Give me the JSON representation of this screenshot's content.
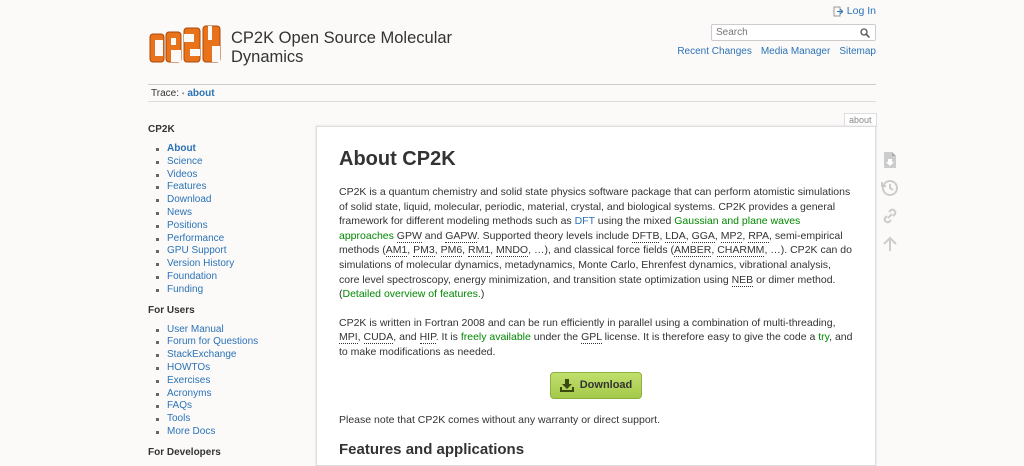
{
  "site": {
    "title": "CP2K Open Source Molecular Dynamics",
    "logo_text": "CP2K"
  },
  "usertools": {
    "login": "Log In"
  },
  "search": {
    "placeholder": "Search"
  },
  "toolnav": [
    "Recent Changes",
    "Media Manager",
    "Sitemap"
  ],
  "breadcrumb": {
    "label": "Trace:",
    "sep": "•",
    "current": "about"
  },
  "sidebar": {
    "sections": [
      {
        "title": "CP2K",
        "items": [
          "About",
          "Science",
          "Videos",
          "Features",
          "Download",
          "News",
          "Positions",
          "Performance",
          "GPU Support",
          "Version History",
          "Foundation",
          "Funding"
        ]
      },
      {
        "title": "For Users",
        "items": [
          "User Manual",
          "Forum for Questions",
          "StackExchange",
          "HOWTOs",
          "Exercises",
          "Acronyms",
          "FAQs",
          "Tools",
          "More Docs"
        ]
      },
      {
        "title": "For Developers",
        "items": []
      }
    ]
  },
  "page": {
    "tab": "about",
    "title": "About CP2K",
    "p1": {
      "t1": "CP2K is a quantum chemistry and solid state physics software package that can perform atomistic simulations of solid state, liquid, molecular, periodic, material, crystal, and biological systems. CP2K provides a general framework for different modeling methods such as ",
      "dft": "DFT",
      "t2": " using the mixed ",
      "gpw_link": "Gaussian and plane waves approaches",
      "t3": " ",
      "gpw": "GPW",
      "t4": " and ",
      "gapw": "GAPW",
      "t5": ". Supported theory levels include ",
      "dftb": "DFTB",
      "c1": ", ",
      "lda": "LDA",
      "c2": ", ",
      "gga": "GGA",
      "c3": ", ",
      "mp2": "MP2",
      "c4": ", ",
      "rpa": "RPA",
      "t6": ", semi-empirical methods (",
      "am1": "AM1",
      "c5": ", ",
      "pm3": "PM3",
      "c6": ", ",
      "pm6": "PM6",
      "c7": ", ",
      "rm1": "RM1",
      "c8": ", ",
      "mndo": "MNDO",
      "t7": ", …), and classical force fields (",
      "amber": "AMBER",
      "c9": ", ",
      "charmm": "CHARMM",
      "t8": ", …). CP2K can do simulations of molecular dynamics, metadynamics, Monte Carlo, Ehrenfest dynamics, vibrational analysis, core level spectroscopy, energy minimization, and transition state optimization using ",
      "neb": "NEB",
      "t9": " or dimer method.",
      "t10": "(",
      "overview": "Detailed overview of features.",
      "t11": ")"
    },
    "p2": {
      "t1": "CP2K is written in Fortran 2008 and can be run efficiently in parallel using a combination of multi-threading, ",
      "mpi": "MPI",
      "c1": ", ",
      "cuda": "CUDA",
      "t2": ", and ",
      "hip": "HIP",
      "t3": ". It is ",
      "free": "freely available",
      "t4": " under the ",
      "gpl": "GPL",
      "t5": " license. It is therefore easy to give the code a ",
      "try": "try",
      "t6": ", and to make modifications as needed."
    },
    "download_label": "Download",
    "p3": "Please note that CP2K comes without any warranty or direct support.",
    "h2": "Features and applications"
  },
  "pagetools": [
    "export-pdf-icon",
    "old-revisions-icon",
    "backlinks-icon",
    "back-to-top-icon"
  ]
}
